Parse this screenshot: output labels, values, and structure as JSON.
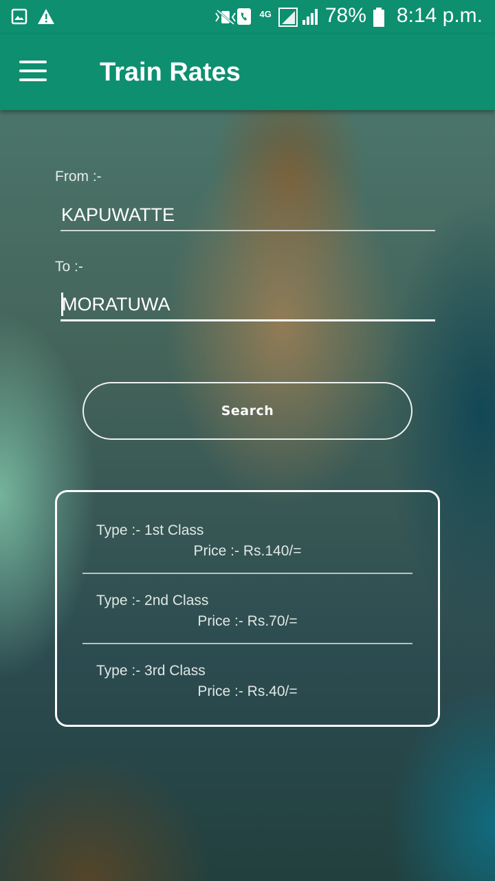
{
  "status_bar": {
    "battery": "78%",
    "time": "8:14 p.m.",
    "network": "4G",
    "icons": [
      "image-icon",
      "warning-icon",
      "vibrate-icon",
      "call-icon",
      "signal-icon",
      "battery-icon"
    ]
  },
  "app_bar": {
    "title": "Train Rates",
    "menu_icon": "hamburger-icon"
  },
  "form": {
    "from_label": "From :-",
    "from_value": "KAPUWATTE",
    "to_label": "To :-",
    "to_value": "MORATUWA",
    "search_label": "Search"
  },
  "rates": [
    {
      "type": "Type :- 1st Class",
      "price": "Price :- Rs.140/="
    },
    {
      "type": "Type :- 2nd Class",
      "price": "Price :- Rs.70/="
    },
    {
      "type": "Type :- 3rd Class",
      "price": "Price :- Rs.40/="
    }
  ],
  "colors": {
    "primary": "#0d8f70",
    "text": "#ffffff"
  }
}
